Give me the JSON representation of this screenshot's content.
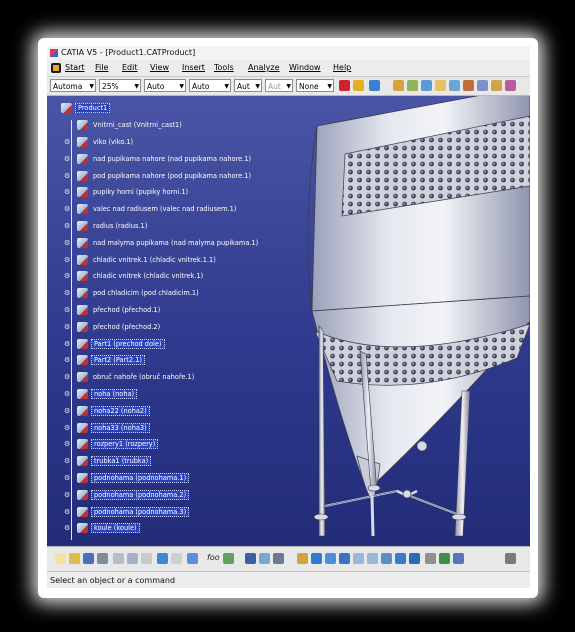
{
  "window": {
    "title": "CATIA V5 - [Product1.CATProduct]"
  },
  "menu": {
    "items": [
      "Start",
      "File",
      "Edit",
      "View",
      "Insert",
      "Tools",
      "Analyze",
      "Window",
      "Help"
    ]
  },
  "toolbar": {
    "combos": [
      {
        "value": "Automa",
        "disabled": false
      },
      {
        "value": "25%",
        "disabled": false
      },
      {
        "value": "Auto",
        "disabled": false
      },
      {
        "value": "Auto",
        "disabled": false
      },
      {
        "value": "Aut",
        "disabled": false
      },
      {
        "value": "Aut",
        "disabled": true
      },
      {
        "value": "None",
        "disabled": false
      }
    ]
  },
  "tree": {
    "root": "Product1",
    "child": "Vnitrni_cast (Vnitrni_cast1)",
    "items": [
      {
        "label": "viko (viko.1)",
        "selected": false
      },
      {
        "label": "nad pupikama nahore (nad pupikama nahore.1)",
        "selected": false
      },
      {
        "label": "pod pupikama nahore (pod pupikama nahore.1)",
        "selected": false
      },
      {
        "label": "pupiky horni (pupiky horni.1)",
        "selected": false
      },
      {
        "label": "valec nad radiusem (valec nad radiusem.1)",
        "selected": false
      },
      {
        "label": "radius (radius.1)",
        "selected": false
      },
      {
        "label": "nad malyma pupikama (nad malyma pupikama.1)",
        "selected": false
      },
      {
        "label": "chladic vnitrek.1 (chladic vnitrek.1.1)",
        "selected": false
      },
      {
        "label": "chladic vnitrek (chladic vnitrek.1)",
        "selected": false
      },
      {
        "label": "pod chladicim (pod chladicim.1)",
        "selected": false
      },
      {
        "label": "přechod (přechod.1)",
        "selected": false
      },
      {
        "label": "přechod (přechod.2)",
        "selected": false
      },
      {
        "label": "Part1 (prechod dole)",
        "selected": true
      },
      {
        "label": "Part2 (Part2.1)",
        "selected": true
      },
      {
        "label": "obruč nahoře (obruč nahoře.1)",
        "selected": false
      },
      {
        "label": "noha (noha)",
        "selected": true
      },
      {
        "label": "noha22 (noha2)",
        "selected": true
      },
      {
        "label": "noha33 (noha3)",
        "selected": true
      },
      {
        "label": "rozpery1 (rozpery)",
        "selected": true
      },
      {
        "label": "trubka1 (trubka)",
        "selected": true
      },
      {
        "label": "podnohama (podnohama.1)",
        "selected": true
      },
      {
        "label": "podnohama (podnohama.2)",
        "selected": true
      },
      {
        "label": "podnohama (podnohama.3)",
        "selected": true
      },
      {
        "label": "koule (koule)",
        "selected": true
      }
    ]
  },
  "bottom_toolbar": {
    "label": "foo"
  },
  "status": {
    "text": "Select an object or a command"
  },
  "colors": {
    "viewport_bg": "#2f3a8e",
    "selection": "#2c43b8",
    "tank": "#d8dbe6"
  }
}
